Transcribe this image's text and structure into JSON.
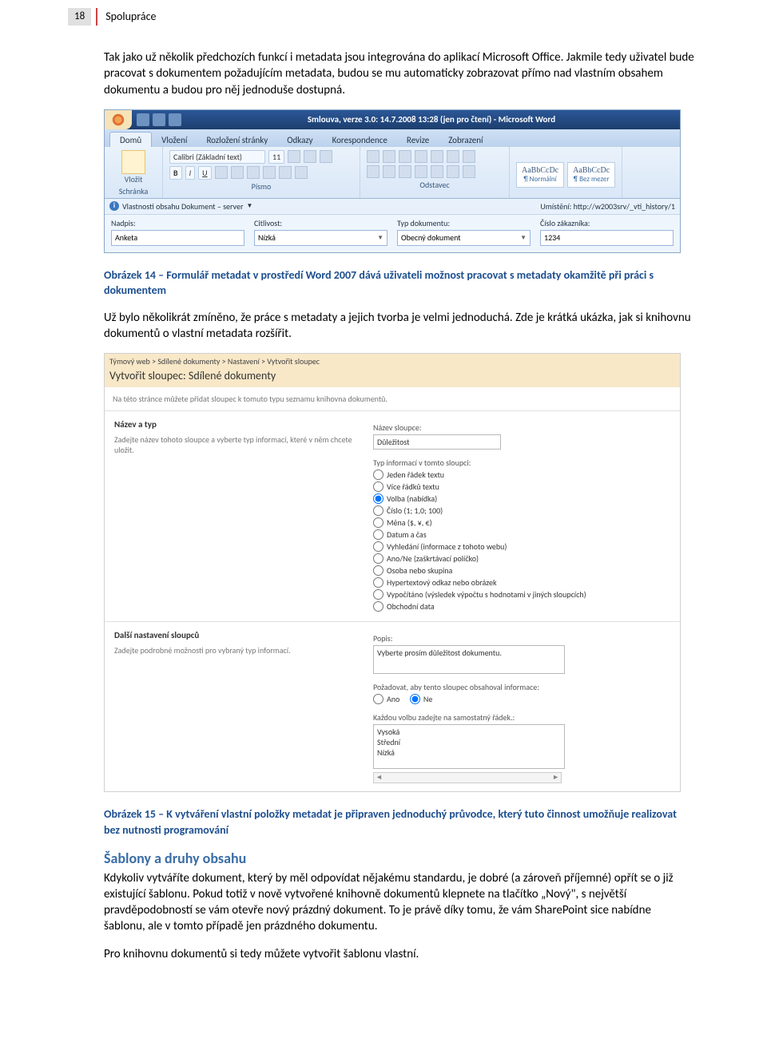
{
  "header": {
    "page_number": "18",
    "section": "Spolupráce"
  },
  "intro_para": "Tak jako už několik předchozích funkcí i metadata jsou integrována do aplikací Microsoft Office. Jakmile tedy uživatel bude pracovat s dokumentem požadujícím metadata, budou se mu automaticky zobrazovat přímo nad vlastním obsahem dokumentu a budou pro něj jednoduše dostupná.",
  "word": {
    "title": "Smlouva, verze 3.0: 14.7.2008 13:28 (jen pro čtení)  -  Microsoft Word",
    "tabs": [
      "Domů",
      "Vložení",
      "Rozložení stránky",
      "Odkazy",
      "Korespondence",
      "Revize",
      "Zobrazení"
    ],
    "groups": {
      "clipboard": "Schránka",
      "font": "Písmo",
      "paragraph": "Odstavec",
      "paste": "Vložit"
    },
    "font_name": "Calibri (Základní text)",
    "font_size": "11",
    "style1": {
      "sample": "AaBbCcDc",
      "name": "¶ Normální"
    },
    "style2": {
      "sample": "AaBbCcDc",
      "name": "¶ Bez mezer"
    },
    "info_bar_left": "Vlastnosti obsahu Dokument – server",
    "info_bar_right_label": "Umístění:",
    "info_bar_right_value": "http://w2003srv/_vti_history/1",
    "meta": {
      "nadpis_label": "Nadpis:",
      "nadpis_value": "Anketa",
      "citlivost_label": "Citlivost:",
      "citlivost_value": "Nízká",
      "typ_label": "Typ dokumentu:",
      "typ_value": "Obecný dokument",
      "cislo_label": "Číslo zákazníka:",
      "cislo_value": "1234"
    },
    "bold": "B",
    "italic": "I",
    "underline": "U"
  },
  "caption1": "Obrázek 14 – Formulář metadat v prostředí Word 2007 dává uživateli možnost pracovat s metadaty okamžitě při práci s dokumentem",
  "mid_para": "Už bylo několikrát zmíněno, že práce s metadaty a jejich tvorba je velmi jednoduchá. Zde je krátká ukázka, jak si knihovnu dokumentů o vlastní metadata rozšířit.",
  "sp": {
    "crumb": "Týmový web > Sdílené dokumenty > Nastavení > Vytvořit sloupec",
    "title": "Vytvořit sloupec: Sdílené dokumenty",
    "desc": "Na této stránce můžete přidat sloupec k tomuto typu seznamu knihovna dokumentů.",
    "sec1_h": "Název a typ",
    "sec1_d": "Zadejte název tohoto sloupce a vyberte typ informací, které v něm chcete uložit.",
    "name_label": "Název sloupce:",
    "name_value": "Důležitost",
    "type_label": "Typ informací v tomto sloupci:",
    "types": [
      "Jeden řádek textu",
      "Více řádků textu",
      "Volba (nabídka)",
      "Číslo (1; 1,0; 100)",
      "Měna ($, ¥, €)",
      "Datum a čas",
      "Vyhledání (informace z tohoto webu)",
      "Ano/Ne (zaškrtávací políčko)",
      "Osoba nebo skupina",
      "Hypertextový odkaz nebo obrázek",
      "Vypočítáno (výsledek výpočtu s hodnotami v jiných sloupcích)",
      "Obchodní data"
    ],
    "type_selected_index": 2,
    "sec2_h": "Další nastavení sloupců",
    "sec2_d": "Zadejte podrobné možnosti pro vybraný typ informací.",
    "popis_label": "Popis:",
    "popis_value": "Vyberte prosím důležitost dokumentu.",
    "require_label": "Požadovat, aby tento sloupec obsahoval informace:",
    "yes": "Ano",
    "no": "Ne",
    "each_label": "Každou volbu zadejte na samostatný řádek.:",
    "choices": "Vysoká\nStřední\nNízká"
  },
  "caption2": "Obrázek 15 – K vytváření vlastní položky metadat je připraven jednoduchý průvodce, který tuto činnost umožňuje realizovat bez nutnosti programování",
  "section_title": "Šablony a druhy obsahu",
  "body_para": "Kdykoliv vytváříte dokument, který by měl odpovídat nějakému standardu, je dobré (a zároveň příjemné) opřít se o již existující šablonu. Pokud totiž v nově vytvořené knihovně dokumentů klepnete na tlačítko „Nový\", s největší pravděpodobností se vám otevře nový prázdný dokument. To je právě díky tomu, že vám SharePoint sice nabídne šablonu, ale v tomto případě jen prázdného dokumentu.",
  "last_para": "Pro knihovnu dokumentů si tedy můžete vytvořit šablonu vlastní."
}
